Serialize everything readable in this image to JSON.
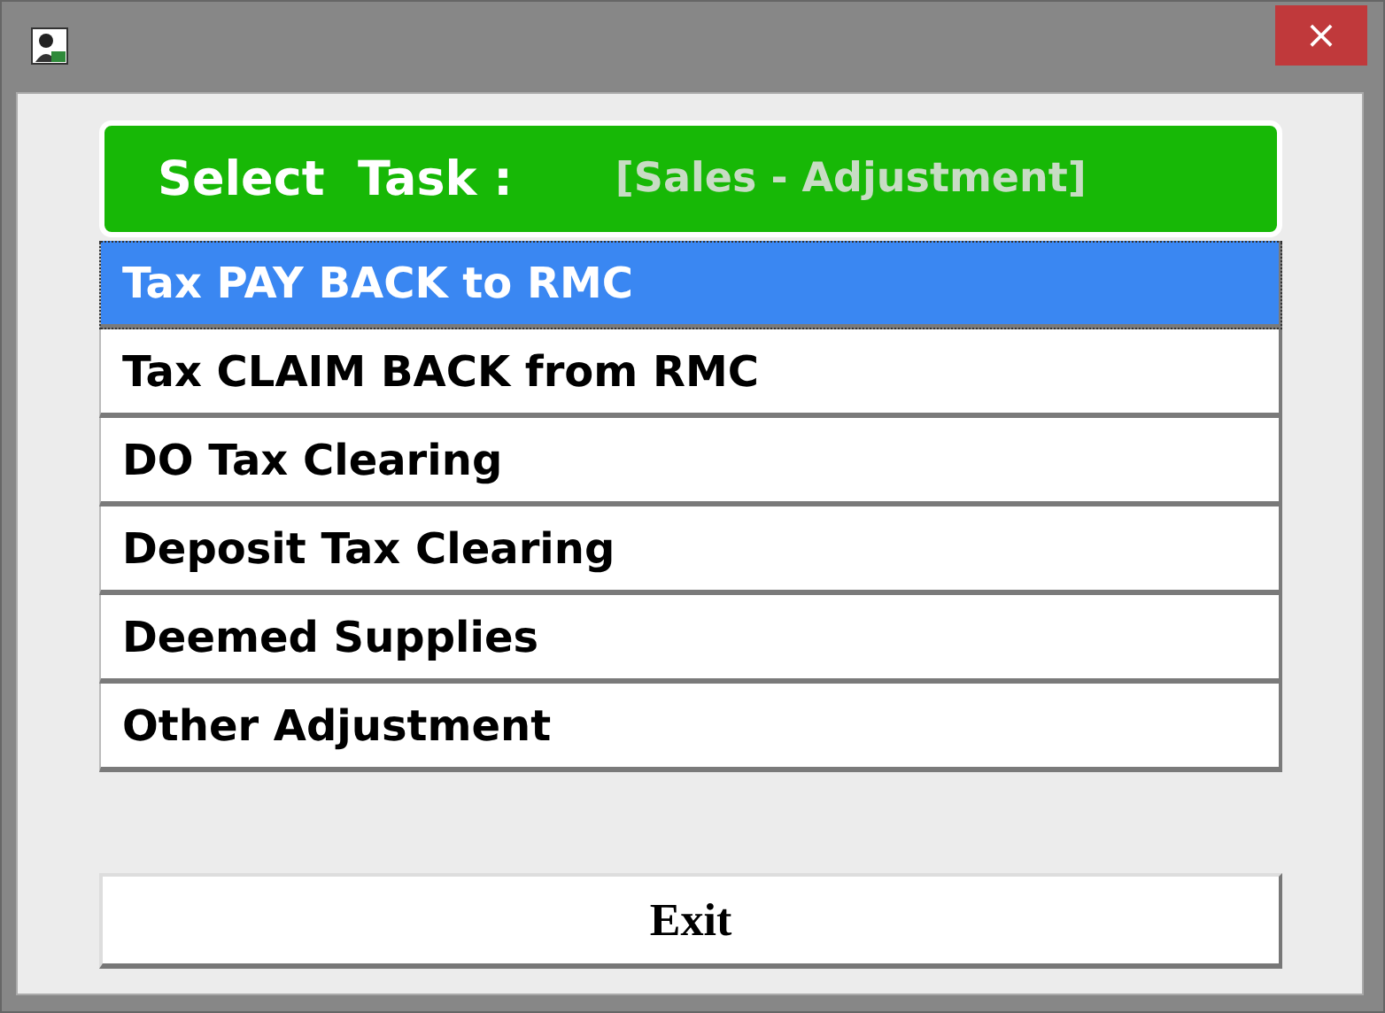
{
  "window": {
    "close_button": "×"
  },
  "header": {
    "title": "Select  Task :",
    "subtitle": "[Sales - Adjustment]"
  },
  "tasks": [
    {
      "label": "Tax PAY BACK to RMC",
      "selected": true
    },
    {
      "label": "Tax CLAIM BACK from RMC",
      "selected": false
    },
    {
      "label": "DO Tax Clearing",
      "selected": false
    },
    {
      "label": "Deposit Tax Clearing",
      "selected": false
    },
    {
      "label": "Deemed Supplies",
      "selected": false
    },
    {
      "label": "Other Adjustment",
      "selected": false
    }
  ],
  "exit_button": "Exit"
}
